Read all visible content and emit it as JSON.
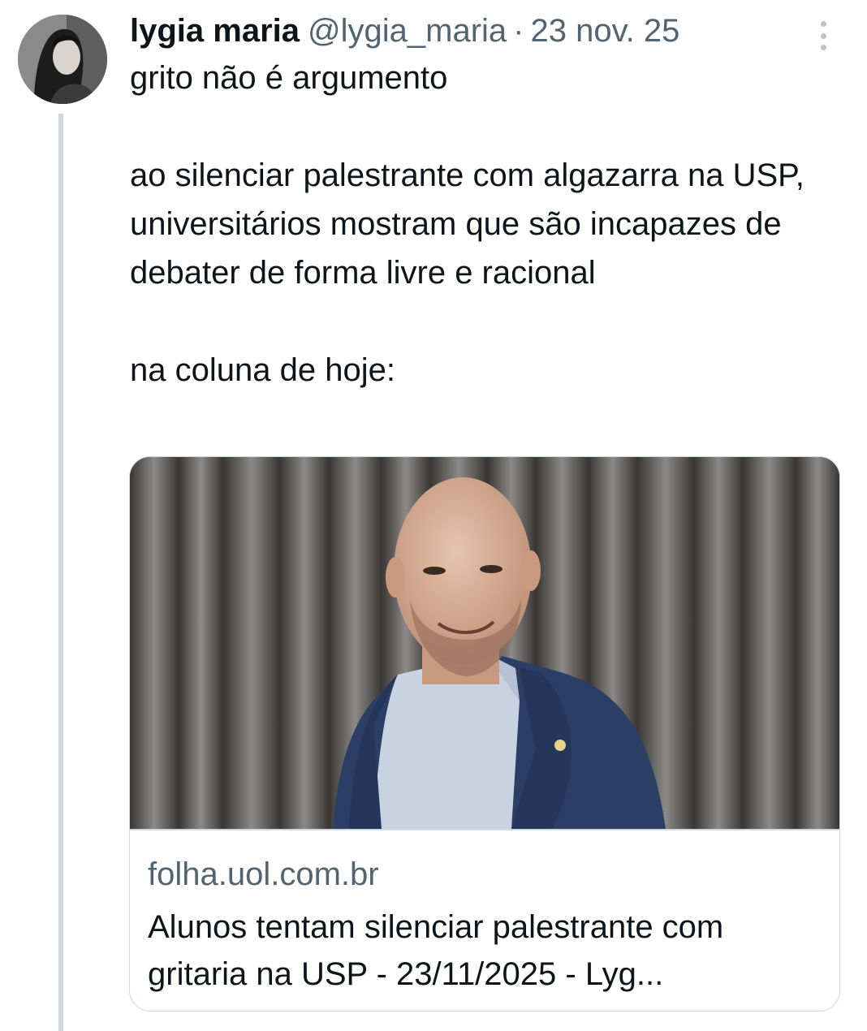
{
  "tweet": {
    "author_name": "lygia maria",
    "author_handle": "@lygia_maria",
    "separator": "·",
    "date": "23 nov. 25",
    "text_lines": [
      "grito não é argumento",
      "ao silenciar palestrante com algazarra na USP, universitários mostram que são incapazes de debater de forma livre e racional",
      "na coluna de hoje:"
    ]
  },
  "link_card": {
    "domain": "folha.uol.com.br",
    "title": "Alunos tentam silenciar palestrante com gritaria na USP - 23/11/2025 - Lyg..."
  },
  "icons": {
    "more": "more-vertical-icon",
    "avatar": "profile-photo"
  },
  "colors": {
    "text_primary": "#0f1419",
    "text_secondary": "#536471",
    "border": "#cfd9de",
    "thread_line": "#cfd9de"
  }
}
